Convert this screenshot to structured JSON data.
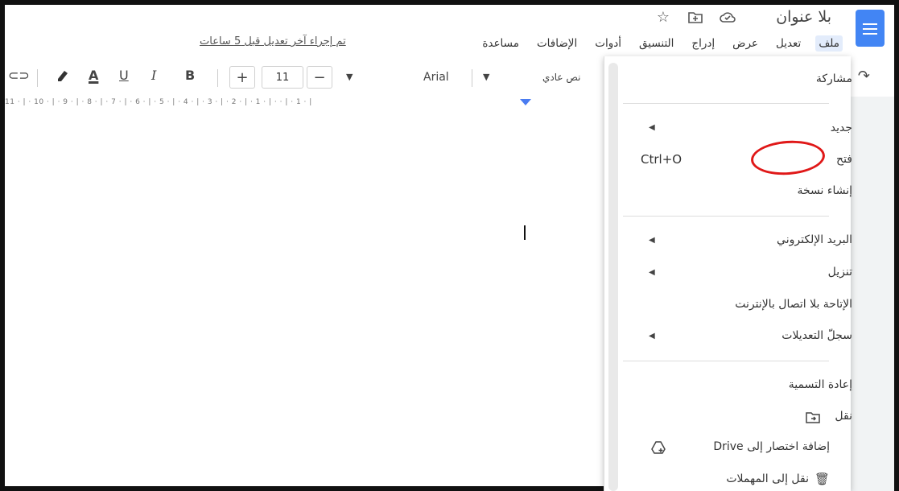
{
  "header": {
    "doc_title": "بلا عنوان",
    "last_edit": "تم إجراء آخر تعديل قبل 5 ساعات",
    "title_icons": [
      "star-icon",
      "move-to-folder-icon",
      "cloud-saved-icon"
    ]
  },
  "menubar": {
    "items": [
      "ملف",
      "تعديل",
      "عرض",
      "إدراج",
      "التنسيق",
      "أدوات",
      "الإضافات",
      "مساعدة"
    ]
  },
  "toolbar": {
    "style": "نص عادي",
    "font": "Arial",
    "font_size": "11",
    "decrease": "−",
    "increase": "+",
    "bold": "B",
    "italic": "I",
    "underline": "U",
    "text_color": "A"
  },
  "ruler": {
    "text": "11 · | · 10 · | · 9 · | · 8 · | · 7 · | · 6 · | · 5 · | · 4 · | · 3 · | · 2 · | · 1 · | ·       · | · 1 · |"
  },
  "file_menu": {
    "share": "مشاركة",
    "new": "جديد",
    "open": "فتح",
    "open_shortcut": "Ctrl+O",
    "make_copy": "إنشاء نسخة",
    "email": "البريد الإلكتروني",
    "download": "تنزيل",
    "offline": "الإتاحة بلا اتصال بالإنترنت",
    "version_history": "سجلّ التعديلات",
    "rename": "إعادة التسمية",
    "move": "نقل",
    "add_shortcut": "إضافة اختصار إلى Drive",
    "move_to_trash": "نقل إلى المهملات"
  },
  "colors": {
    "accent": "#4285f4",
    "annotation": "#e01818"
  }
}
